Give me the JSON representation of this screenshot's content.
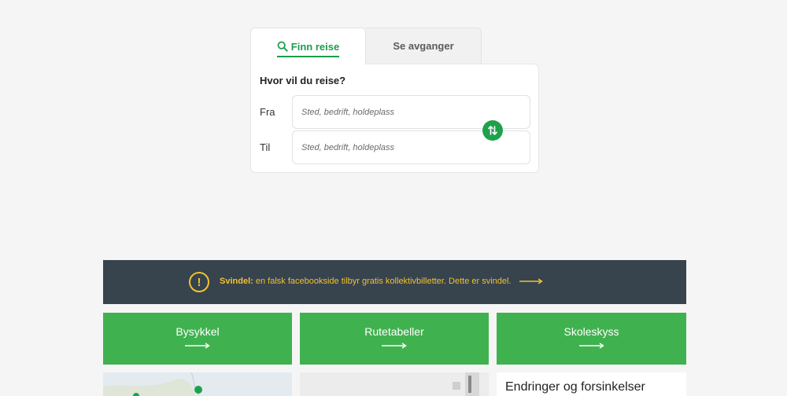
{
  "search": {
    "tabs": [
      {
        "label": "Finn reise",
        "icon": "search-icon",
        "active": true
      },
      {
        "label": "Se avganger",
        "active": false
      }
    ],
    "question": "Hvor vil du reise?",
    "from_label": "Fra",
    "to_label": "Til",
    "from_placeholder": "Sted, bedrift, holdeplass",
    "to_placeholder": "Sted, bedrift, holdeplass",
    "swap_icon": "swap-vertical-icon"
  },
  "alert": {
    "icon": "exclamation-icon",
    "bold": "Svindel:",
    "text": " en falsk facebookside tilbyr gratis kollektivbilletter. Dette er svindel.",
    "color": "#f2c12e",
    "background": "#37434d"
  },
  "tiles": [
    {
      "label": "Bysykkel"
    },
    {
      "label": "Rutetabeller"
    },
    {
      "label": "Skoleskyss"
    }
  ],
  "news": {
    "title": "Endringer og forsinkelser"
  },
  "colors": {
    "accent": "#1b9e4b",
    "tile": "#3fb24f"
  }
}
